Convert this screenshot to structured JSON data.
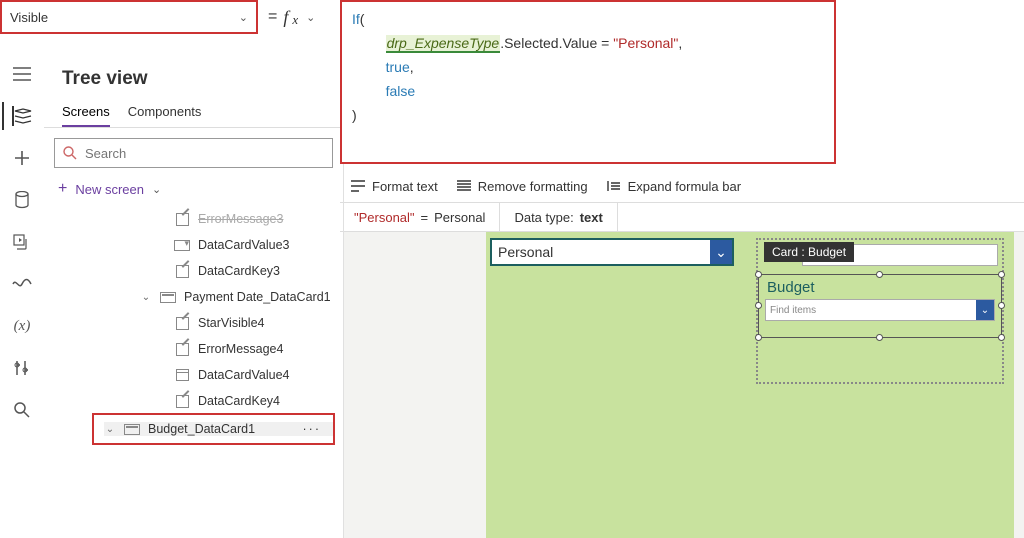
{
  "property_dropdown": "Visible",
  "fx_equals": "=",
  "fx_symbol": "fx",
  "formula": {
    "kw_if": "If",
    "open": "(",
    "var": "drp_ExpenseType",
    "member": ".Selected.Value = ",
    "str": "\"Personal\"",
    "comma": ",",
    "true_kw": "true",
    "false_kw": "false",
    "close": ")"
  },
  "formula_toolbar": {
    "format": "Format text",
    "remove": "Remove formatting",
    "expand": "Expand formula bar"
  },
  "info": {
    "literal": "\"Personal\"",
    "eq": "=",
    "resolved": "Personal",
    "dtype_label": "Data type:",
    "dtype": "text"
  },
  "tree": {
    "title": "Tree view",
    "tab_screens": "Screens",
    "tab_components": "Components",
    "search_ph": "Search",
    "new_screen": "New screen",
    "items": {
      "err3": "ErrorMessage3",
      "val3": "DataCardValue3",
      "key3": "DataCardKey3",
      "paydate": "Payment Date_DataCard1",
      "star4": "StarVisible4",
      "err4": "ErrorMessage4",
      "val4": "DataCardValue4",
      "key4": "DataCardKey4",
      "budget": "Budget_DataCard1"
    }
  },
  "canvas": {
    "personal": "Personal",
    "card_tip": "Card : Budget",
    "budget_title": "Budget",
    "find_ph": "Find items"
  }
}
